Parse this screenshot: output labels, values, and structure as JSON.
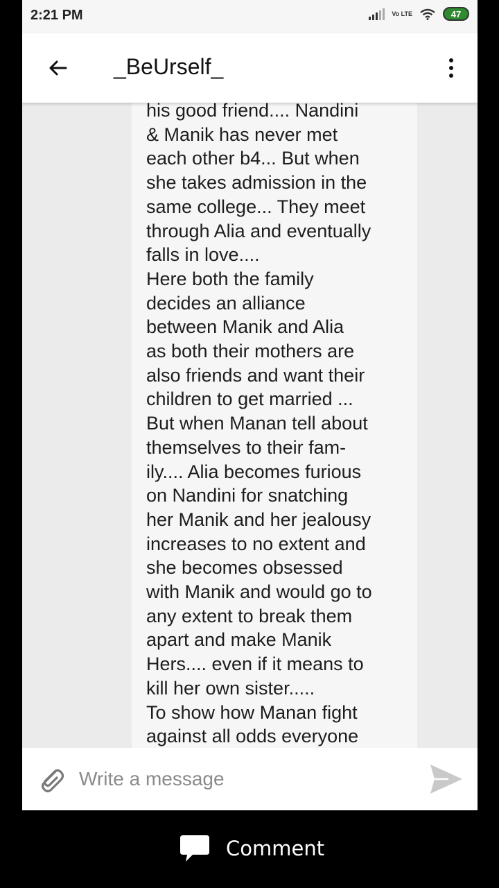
{
  "status_bar": {
    "time": "2:21 PM",
    "network_label": "Vo LTE",
    "battery_level": "47"
  },
  "app_bar": {
    "title": "_BeUrself_",
    "back_icon": "arrow-left-icon",
    "menu_icon": "more-vertical-icon"
  },
  "message": {
    "lines": [
      "his good friend.... Nandini",
      "& Manik has never met",
      "each other b4... But when",
      "she takes admission in the",
      "same college... They meet",
      "through Alia and eventually",
      "falls in love....",
      "Here both the family",
      "decides an alliance",
      "between Manik and Alia",
      "as both their mothers are",
      "also friends and want their",
      "children to get married ...",
      "But when Manan tell about",
      "themselves to their fam-",
      "ily.... Alia becomes furious",
      "on Nandini for snatching",
      "her Manik and her jealousy",
      "increases to no extent and",
      "she becomes obsessed",
      "with Manik and would go to",
      "any extent to break them",
      "apart and make Manik",
      "Hers.... even if it means to",
      "kill her own sister.....",
      "To show how Manan fight",
      "against all odds everyone"
    ]
  },
  "composer": {
    "placeholder": "Write a message",
    "attach_icon": "paperclip-icon",
    "send_icon": "send-icon"
  },
  "comment_bar": {
    "label": "Comment",
    "icon": "speech-bubble-icon"
  },
  "colors": {
    "background": "#000000",
    "app_surface": "#ffffff",
    "content_bg": "#f6f6f6",
    "side_bg": "#ebebeb",
    "battery_green": "#2e8b2e"
  }
}
